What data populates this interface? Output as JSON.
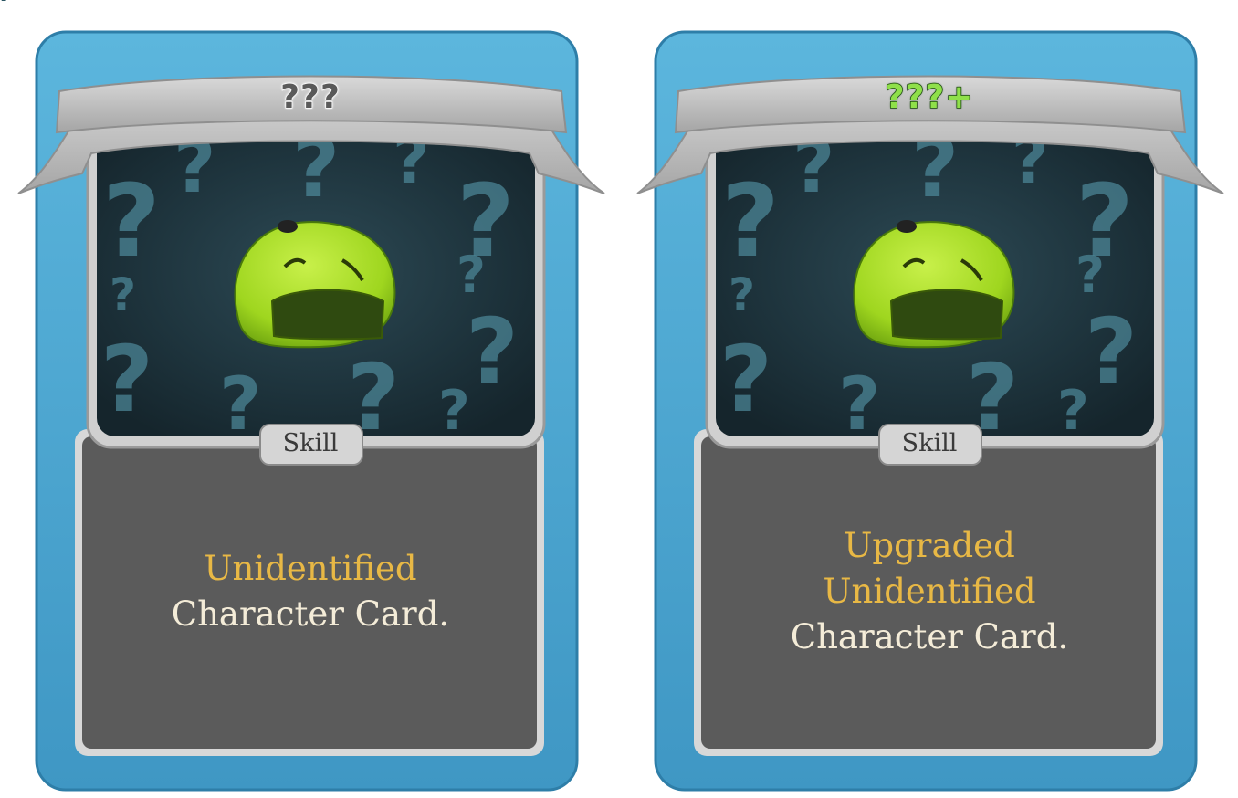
{
  "cards": [
    {
      "title": "???",
      "type": "Skill",
      "description": {
        "keyword_lines": [
          "Unidentified"
        ],
        "text": "Character Card."
      },
      "upgraded": false
    },
    {
      "title": "???+",
      "type": "Skill",
      "description": {
        "keyword_lines": [
          "Upgraded",
          "Unidentified"
        ],
        "text": "Character Card."
      },
      "upgraded": true
    }
  ],
  "colors": {
    "frame_blue": "#4fa7cf",
    "frame_blue_dark": "#2f7fae",
    "description_panel": "#595959",
    "keyword_gold": "#e8b845",
    "text_cream": "#f4ecd8",
    "upgraded_title_green": "#8fe04a",
    "slime_green": "#a7dc2a"
  }
}
